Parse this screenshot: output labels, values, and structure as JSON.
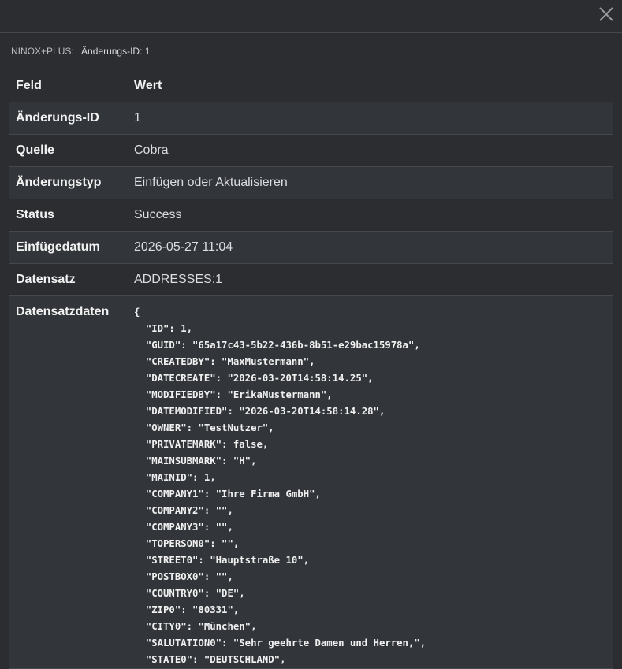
{
  "breadcrumb": {
    "source": "NINOX+PLUS:",
    "current": "Änderungs-ID: 1"
  },
  "icons": {
    "close": "close-icon"
  },
  "colors": {
    "background": "#2b2d31",
    "row_alt": "#32353a",
    "divider": "#45484d",
    "text": "#e8e8e8"
  },
  "table": {
    "headers": {
      "field": "Feld",
      "value": "Wert"
    },
    "rows": [
      {
        "field": "Änderungs-ID",
        "value": "1"
      },
      {
        "field": "Quelle",
        "value": "Cobra"
      },
      {
        "field": "Änderungstyp",
        "value": "Einfügen oder Aktualisieren"
      },
      {
        "field": "Status",
        "value": "Success"
      },
      {
        "field": "Einfügedatum",
        "value": "2026-05-27 11:04"
      },
      {
        "field": "Datensatz",
        "value": "ADDRESSES:1"
      },
      {
        "field": "Datensatzdaten",
        "value": "{\n  \"ID\": 1,\n  \"GUID\": \"65a17c43-5b22-436b-8b51-e29bac15978a\",\n  \"CREATEDBY\": \"MaxMustermann\",\n  \"DATECREATE\": \"2026-03-20T14:58:14.25\",\n  \"MODIFIEDBY\": \"ErikaMustermann\",\n  \"DATEMODIFIED\": \"2026-03-20T14:58:14.28\",\n  \"OWNER\": \"TestNutzer\",\n  \"PRIVATEMARK\": false,\n  \"MAINSUBMARK\": \"H\",\n  \"MAINID\": 1,\n  \"COMPANY1\": \"Ihre Firma GmbH\",\n  \"COMPANY2\": \"\",\n  \"COMPANY3\": \"\",\n  \"TOPERSON0\": \"\",\n  \"STREET0\": \"Hauptstraße 10\",\n  \"POSTBOX0\": \"\",\n  \"COUNTRY0\": \"DE\",\n  \"ZIP0\": \"80331\",\n  \"CITY0\": \"München\",\n  \"SALUTATION0\": \"Sehr geehrte Damen und Herren,\",\n  \"STATE0\": \"DEUTSCHLAND\","
      }
    ]
  }
}
